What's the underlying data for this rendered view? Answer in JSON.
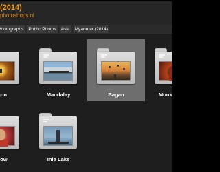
{
  "header": {
    "title": "(2014)",
    "subtitle": "photoshops.nl"
  },
  "breadcrumbs": [
    "Photographs",
    "Public Photos",
    "Asia",
    "Myanmar (2014)"
  ],
  "folders": [
    {
      "label": "ygon",
      "thumb": "pagoda-photo"
    },
    {
      "label": "Mandalay",
      "thumb": "bridge-photo"
    },
    {
      "label": "Bagan",
      "thumb": "balloons-photo",
      "selected": true
    },
    {
      "label": "Monk Initiati",
      "thumb": "monk-photo"
    },
    {
      "label": "show",
      "thumb": "child-photo"
    },
    {
      "label": "Inle Lake",
      "thumb": "fisherman-photo"
    }
  ],
  "colors": {
    "title": "#f29a1d",
    "header_bg": "#262626",
    "grid_bg": "#1e1e1e",
    "selected_tile": "#6e6e6e",
    "folder": "#cfcfcf"
  }
}
